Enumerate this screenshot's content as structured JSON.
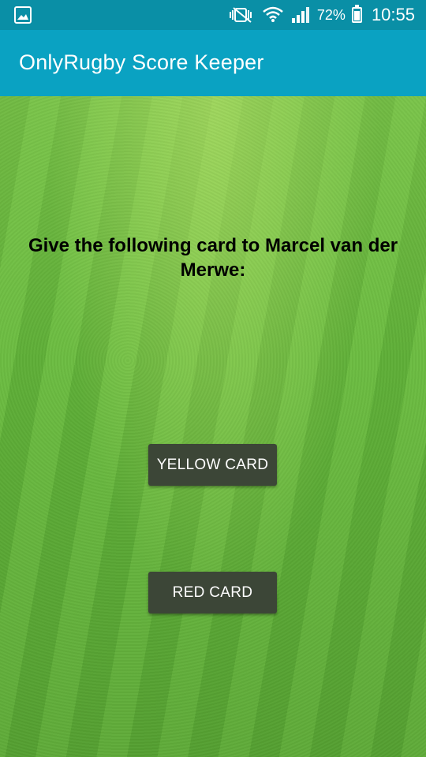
{
  "status_bar": {
    "battery_percent": "72%",
    "battery_level": 0.72,
    "time": "10:55",
    "icons": [
      "image-notification-icon",
      "mute-vibrate-icon",
      "wifi-icon",
      "signal-icon",
      "battery-icon"
    ]
  },
  "app_bar": {
    "title": "OnlyRugby Score Keeper",
    "color": "#0aa2c2"
  },
  "main": {
    "message": "Give the following card to Marcel van der Merwe:",
    "yellow_card_label": "YELLOW CARD",
    "red_card_label": "RED CARD"
  },
  "colors": {
    "status_bar": "#0a8fa6",
    "button_bg": "#3c4637",
    "grass": "#5faf38"
  }
}
